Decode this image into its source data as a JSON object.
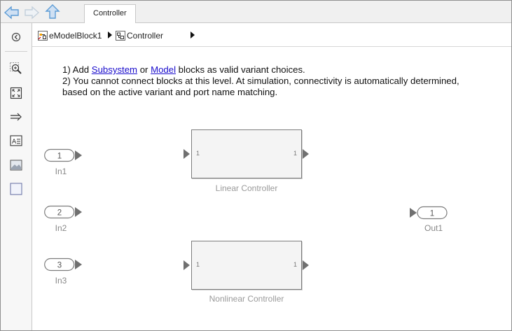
{
  "window": {
    "tab_title": "Controller"
  },
  "breadcrumb": {
    "items": [
      {
        "label": "eModelBlock1"
      },
      {
        "label": "Controller"
      }
    ]
  },
  "canvas": {
    "note_line1_prefix": "1) Add ",
    "note_link_subsystem": "Subsystem",
    "note_line1_mid": " or ",
    "note_link_model": "Model",
    "note_line1_suffix": " blocks as valid variant choices.",
    "note_line2": "2) You cannot connect blocks at this level. At simulation, connectivity is automatically determined, based on the active variant and port name matching."
  },
  "ports": {
    "in1": {
      "number": "1",
      "name": "In1"
    },
    "in2": {
      "number": "2",
      "name": "In2"
    },
    "in3": {
      "number": "3",
      "name": "In3"
    },
    "out1": {
      "number": "1",
      "name": "Out1"
    }
  },
  "blocks": {
    "linear": {
      "name": "Linear Controller",
      "in_port": "1",
      "out_port": "1"
    },
    "nonlinear": {
      "name": "Nonlinear Controller",
      "in_port": "1",
      "out_port": "1"
    }
  },
  "colors": {
    "nav_arrow": "#5b9bd5",
    "link": "#1a0dcc",
    "block_border": "#7c7c7c",
    "port_label": "#888888"
  }
}
